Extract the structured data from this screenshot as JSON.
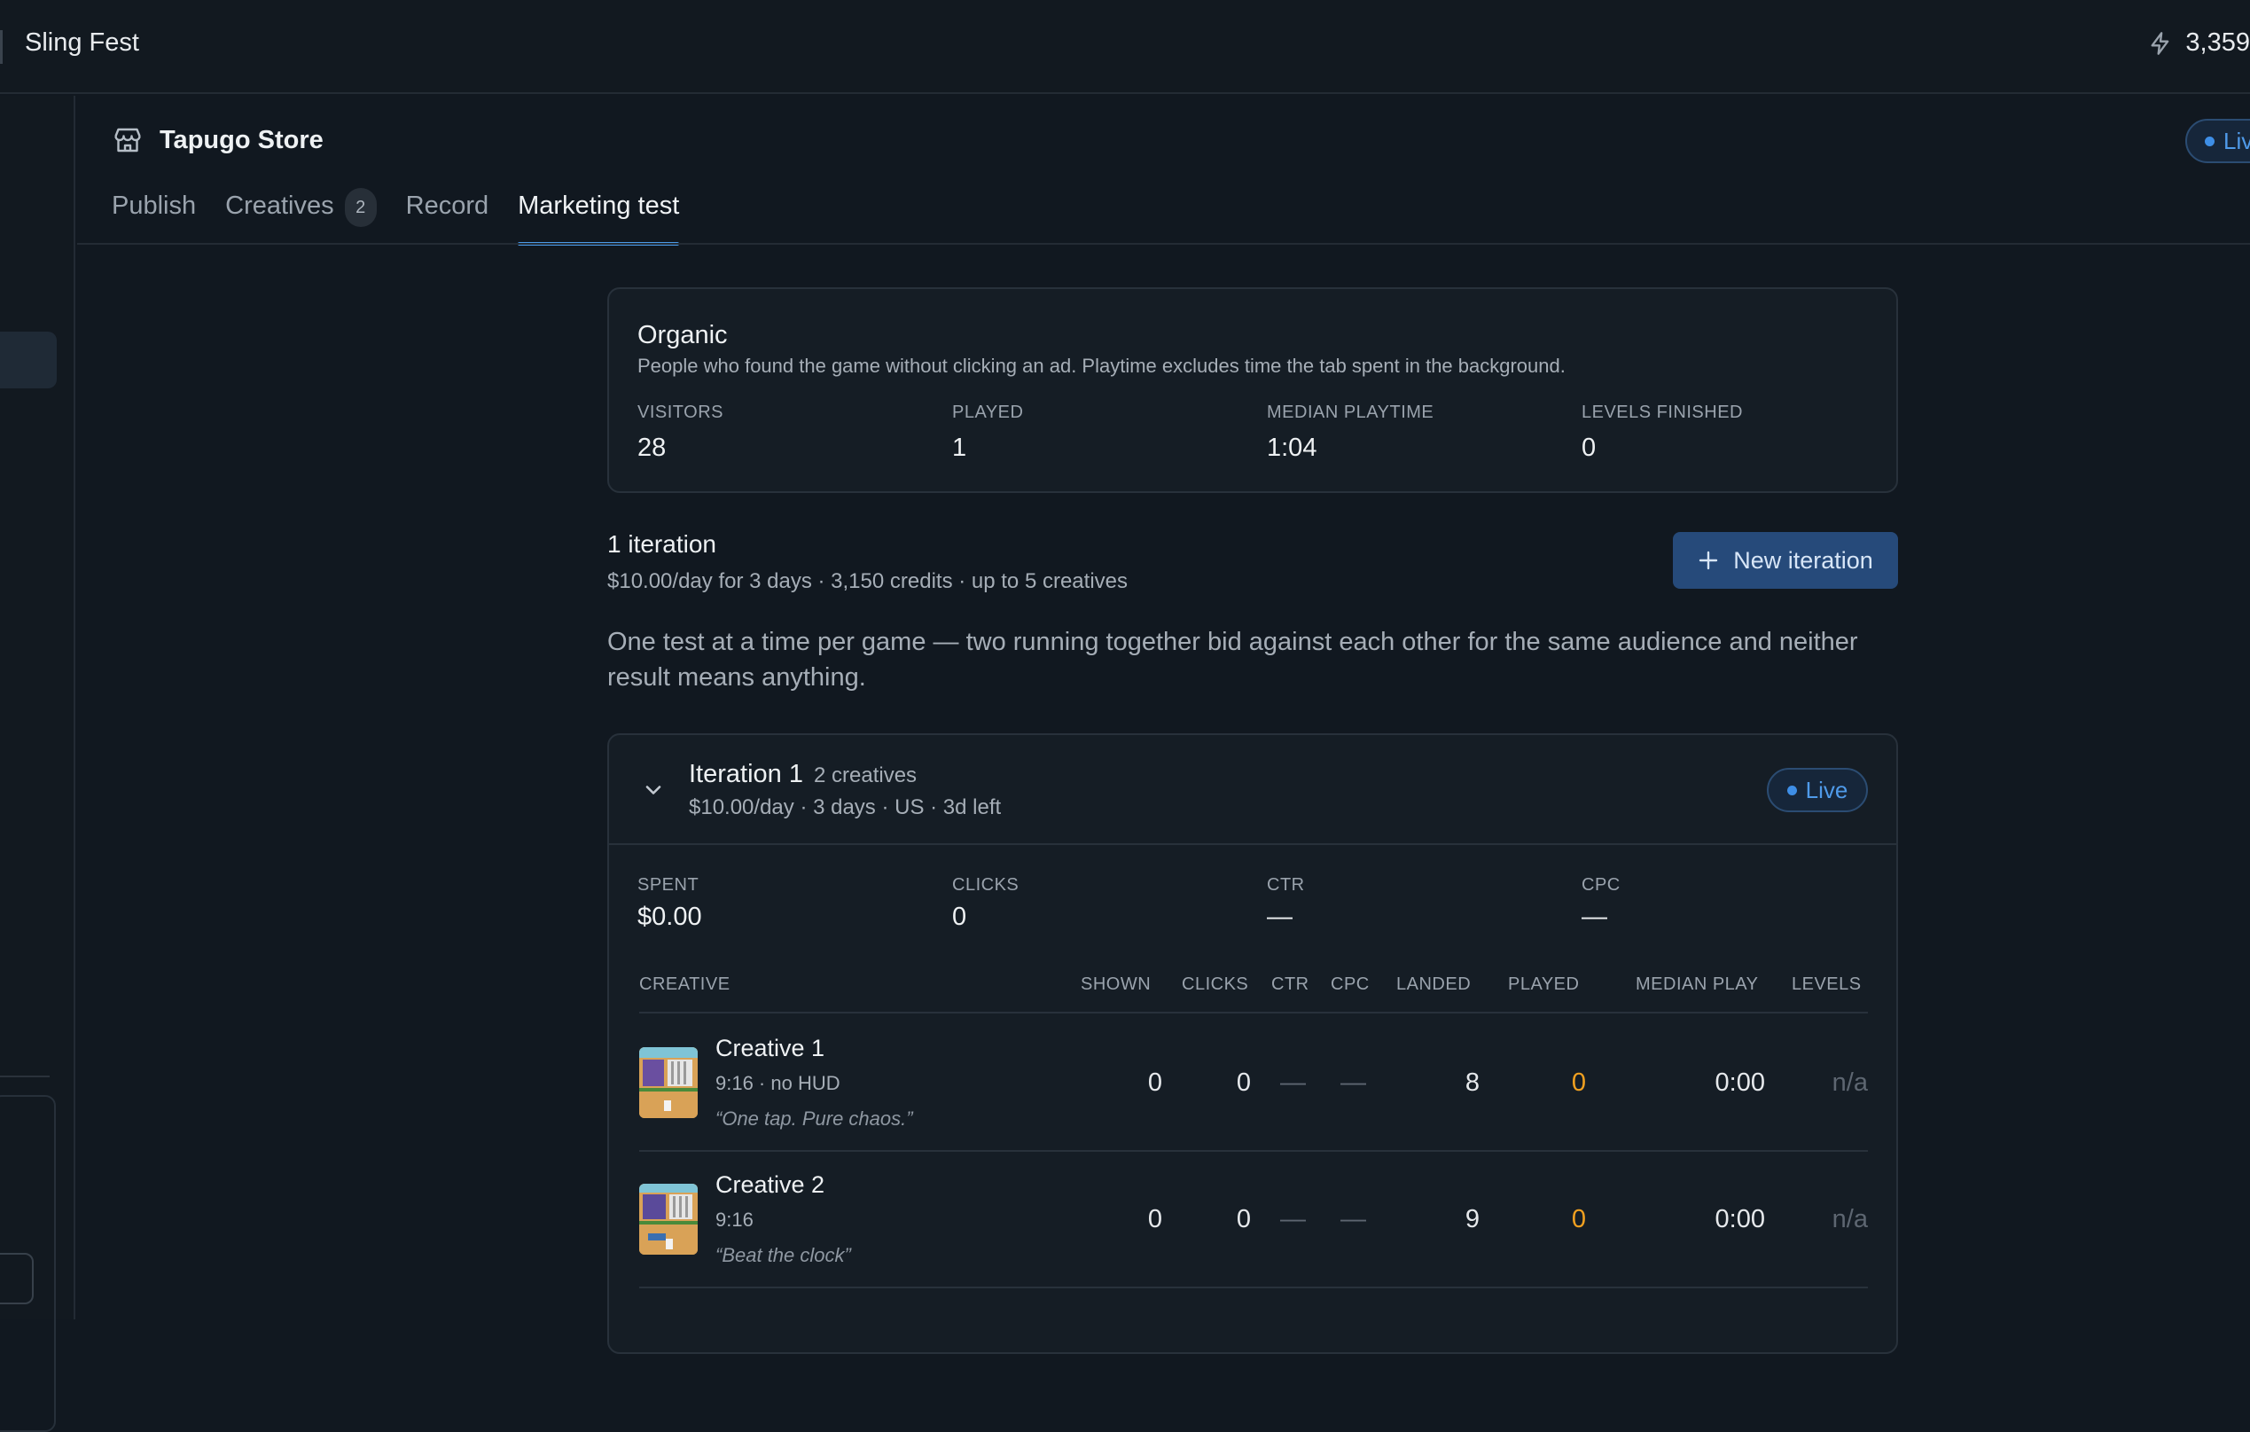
{
  "app": {
    "title": "Sling Fest",
    "credits": "3,359",
    "credits_icon": "lightning-icon"
  },
  "store": {
    "name": "Tapugo Store",
    "status": "Live",
    "icon": "store-icon"
  },
  "tabs": [
    {
      "label": "Publish"
    },
    {
      "label": "Creatives",
      "badge": "2"
    },
    {
      "label": "Record"
    },
    {
      "label": "Marketing test",
      "active": true
    }
  ],
  "organic": {
    "title": "Organic",
    "description": "People who found the game without clicking an ad. Playtime excludes time the tab spent in the background.",
    "stats": [
      {
        "label": "VISITORS",
        "value": "28"
      },
      {
        "label": "PLAYED",
        "value": "1"
      },
      {
        "label": "MEDIAN PLAYTIME",
        "value": "1:04"
      },
      {
        "label": "LEVELS FINISHED",
        "value": "0"
      }
    ]
  },
  "iterations_summary": {
    "title": "1 iteration",
    "subtitle": "$10.00/day for 3 days · 3,150 credits · up to 5 creatives",
    "new_button": "New iteration"
  },
  "note": "One test at a time per game — two running together bid against each other for the same audience and neither result means anything.",
  "iteration": {
    "name": "Iteration 1",
    "count": "2 creatives",
    "meta": "$10.00/day · 3 days · US · 3d left",
    "status": "Live",
    "stats": [
      {
        "label": "SPENT",
        "value": "$0.00"
      },
      {
        "label": "CLICKS",
        "value": "0"
      },
      {
        "label": "CTR",
        "value": "—"
      },
      {
        "label": "CPC",
        "value": "—"
      }
    ],
    "columns": {
      "creative": "CREATIVE",
      "shown": "SHOWN",
      "clicks": "CLICKS",
      "ctr": "CTR",
      "cpc": "CPC",
      "landed": "LANDED",
      "played": "PLAYED",
      "median": "MEDIAN PLAY",
      "levels": "LEVELS"
    },
    "rows": [
      {
        "name": "Creative 1",
        "meta": "9:16  · no HUD",
        "quote": "“One tap. Pure chaos.”",
        "shown": "0",
        "clicks": "0",
        "ctr": "—",
        "cpc": "—",
        "landed": "8",
        "played": "0",
        "median": "0:00",
        "levels": "n/a"
      },
      {
        "name": "Creative 2",
        "meta": "9:16",
        "quote": "“Beat the clock”",
        "shown": "0",
        "clicks": "0",
        "ctr": "—",
        "cpc": "—",
        "landed": "9",
        "played": "0",
        "median": "0:00",
        "levels": "n/a"
      }
    ]
  },
  "colors": {
    "accent": "#4a9ae9",
    "button": "#264a7a",
    "played": "#f0a020",
    "background": "#111820"
  }
}
